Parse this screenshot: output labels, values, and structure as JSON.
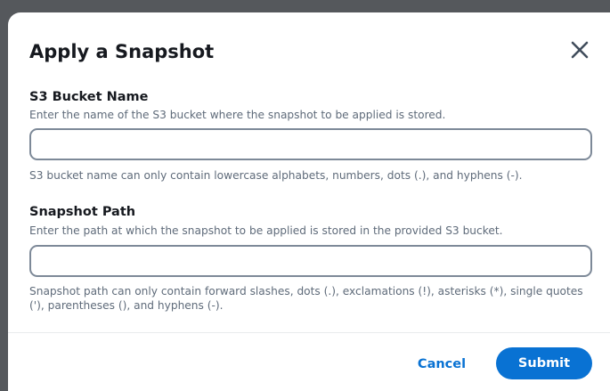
{
  "dialog": {
    "title": "Apply a Snapshot",
    "close_icon": "close-icon"
  },
  "bucket_field": {
    "label": "S3 Bucket Name",
    "description": "Enter the name of the S3 bucket where the snapshot to be applied is stored.",
    "value": "",
    "hint": "S3 bucket name can only contain lowercase alphabets, numbers, dots (.), and hyphens (-)."
  },
  "path_field": {
    "label": "Snapshot Path",
    "description": "Enter the path at which the snapshot to be applied is stored in the provided S3 bucket.",
    "value": "",
    "hint": "Snapshot path can only contain forward slashes, dots (.), exclamations (!), asterisks (*), single quotes ('), parentheses (), and hyphens (-)."
  },
  "footer": {
    "cancel_label": "Cancel",
    "submit_label": "Submit"
  },
  "colors": {
    "primary": "#0972d3",
    "text": "#16191f",
    "secondary_text": "#5f6b7a",
    "input_border": "#7d8998"
  }
}
